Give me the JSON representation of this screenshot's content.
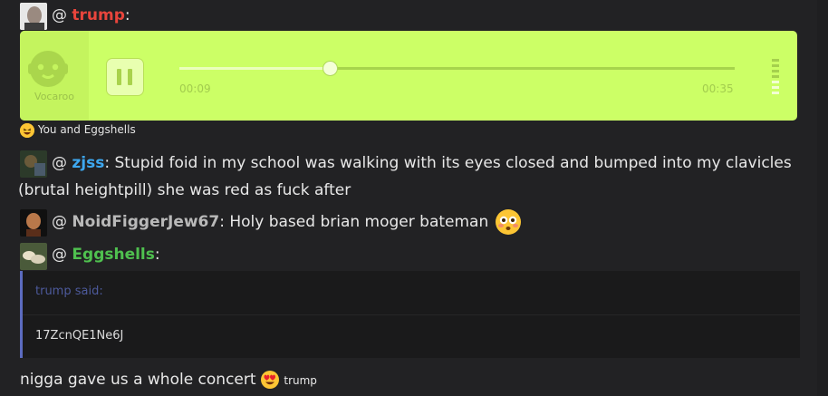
{
  "posts": [
    {
      "at": "@",
      "author": "trump",
      "sep": ":"
    },
    {
      "at": "@",
      "author": "zjss",
      "sep": ":",
      "text_line1": " Stupid foid in my school was walking with its eyes closed and bumped into my clavicles",
      "text_line2": "(brutal heightpill) she was red as fuck after"
    },
    {
      "at": "@",
      "author": "NoidFiggerJew67",
      "sep": ":",
      "text": " Holy based brian moger bateman"
    },
    {
      "at": "@",
      "author": "Eggshells",
      "sep": ":",
      "body": "nigga gave us a whole concert",
      "reaction_by": "trump"
    }
  ],
  "player": {
    "brand": "Vocaroo",
    "elapsed": "00:09",
    "total": "00:35",
    "progress": 0.27,
    "volume_level": 3,
    "volume_max": 7
  },
  "reaction_summary": {
    "text": "You and Eggshells",
    "emoji": "laughing-emoji"
  },
  "quote": {
    "header": "trump said:",
    "body": "17ZcnQE1Ne6J"
  },
  "colors": {
    "trump": "#e8453c",
    "zjss": "#3ea8f0",
    "noid": "#b9b9b9",
    "eggshells": "#4fc04f",
    "player_bg": "#ccff66"
  }
}
